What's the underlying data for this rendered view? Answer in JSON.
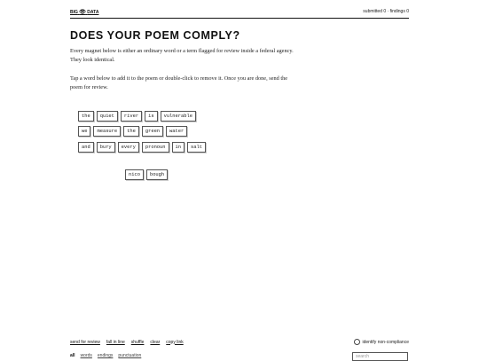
{
  "header": {
    "brand": "BIG",
    "brand_icon": "eye-icon",
    "brand_suffix": "DATA",
    "counts": "submitted 0 · findings 0"
  },
  "main": {
    "title": "DOES YOUR POEM COMPLY?",
    "description_1": "Every magnet below is either an ordinary word or a term flagged for review inside a federal agency. They look identical.",
    "description_2": "Tap a word below to add it to the poem or double-click to remove it. Once you are done, send the poem for review."
  },
  "magnets": {
    "row0": [
      "the",
      "quiet",
      "river",
      "is",
      "vulnerable"
    ],
    "row1": [
      "we",
      "measure",
      "the",
      "green",
      "water"
    ],
    "row2": [
      "and",
      "bury",
      "every",
      "pronoun",
      "in",
      "salt"
    ],
    "row3": [
      "nico",
      "bough"
    ]
  },
  "footer": {
    "send": "send for review",
    "fall": "fall in line",
    "shuffle": "shuffle",
    "clear": "clear",
    "copy": "copy link",
    "identify": "identify non-compliance"
  },
  "filters": {
    "all": "all",
    "words": "words",
    "endings": "endings",
    "punctuation": "punctuation"
  },
  "search": {
    "placeholder": "search"
  }
}
